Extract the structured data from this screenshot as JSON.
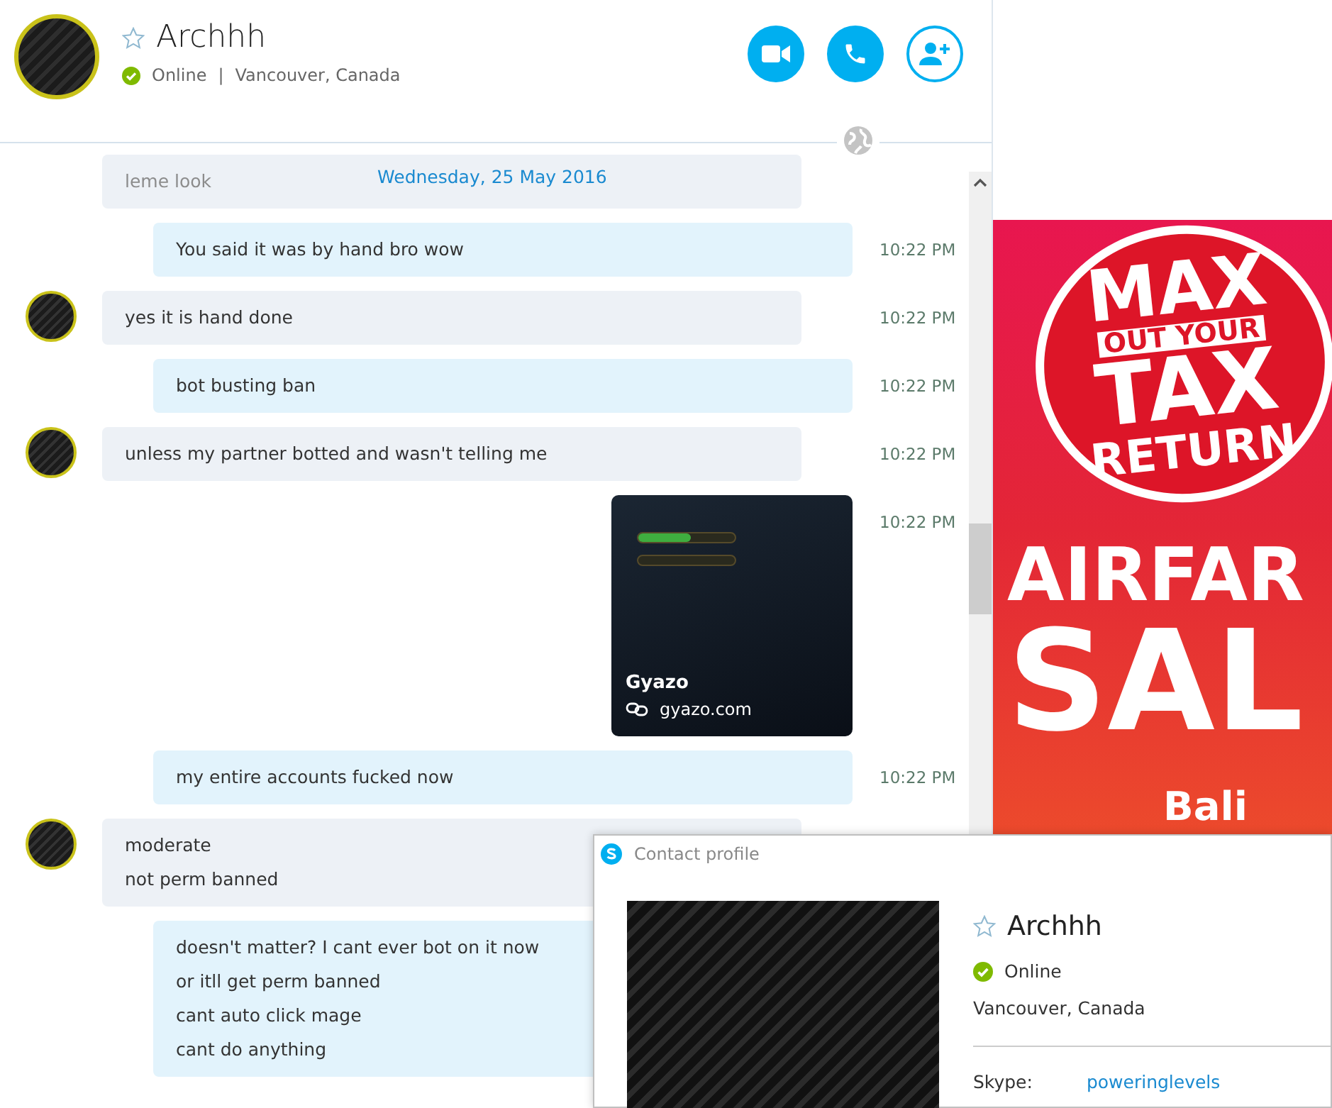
{
  "header": {
    "name": "Archhh",
    "favorite": false,
    "online": true,
    "status": "Online",
    "separator": "|",
    "location": "Vancouver, Canada",
    "buttons": [
      {
        "kind": "video"
      },
      {
        "kind": "call"
      },
      {
        "kind": "add_contact"
      }
    ]
  },
  "history": {
    "text": "leme look",
    "date": "Wednesday, 25 May 2016"
  },
  "messages": [
    {
      "kind": "sent",
      "lines": [
        "You said it was by hand bro wow"
      ],
      "time": "10:22 PM"
    },
    {
      "kind": "received",
      "lines": [
        "yes it is hand done"
      ],
      "time": "10:22 PM"
    },
    {
      "kind": "sent",
      "lines": [
        "bot busting ban"
      ],
      "time": "10:22 PM"
    },
    {
      "kind": "received",
      "lines": [
        "unless my partner botted and wasn't telling me"
      ],
      "time": "10:22 PM"
    },
    {
      "kind": "link",
      "title": "Gyazo",
      "site": "gyazo.com",
      "time": "10:22 PM"
    },
    {
      "kind": "sent",
      "lines": [
        "my entire accounts fucked now"
      ],
      "time": "10:22 PM"
    },
    {
      "kind": "received",
      "lines": [
        "moderate",
        "not perm banned"
      ]
    },
    {
      "kind": "sent",
      "lines": [
        "doesn't matter? I cant ever bot on it now",
        "or itll get perm banned",
        "cant auto click mage",
        "cant do anything"
      ]
    }
  ],
  "ad": {
    "stamp": [
      "MAX",
      "OUT YOUR",
      "TAX",
      "RETURN"
    ],
    "headline": [
      "AIRFAR",
      "SAL"
    ],
    "destination": "Bali"
  },
  "profile_window": {
    "title": "Contact profile",
    "name": "Archhh",
    "favorite": false,
    "online": true,
    "status": "Online",
    "location": "Vancouver, Canada",
    "field_label": "Skype:",
    "field_value": "poweringlevels"
  }
}
